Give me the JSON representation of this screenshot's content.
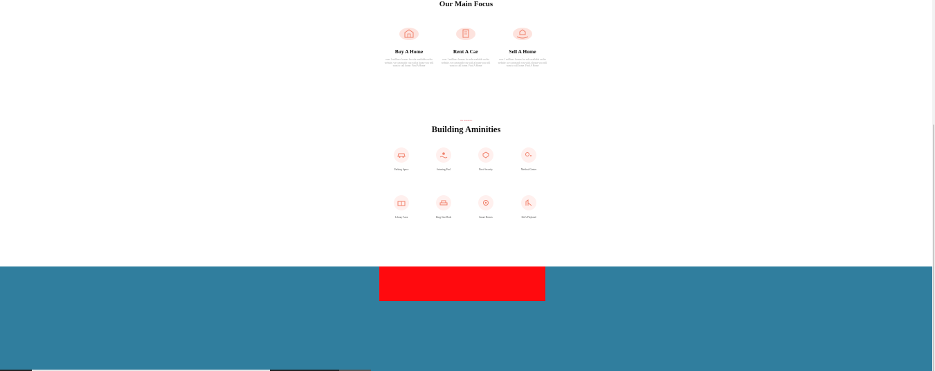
{
  "focus": {
    "heading": "Our Main Focus",
    "items": [
      {
        "title": "Buy A Home",
        "description": "over 1 million+ homes for sale available on the website, we can match you with a house you will want to call home. Find A Home",
        "icon": "house-sign-icon"
      },
      {
        "title": "Rent A Car",
        "description": "over 1 million+ homes for sale available on the website, we can match you with a house you will want to call home. Find A Home",
        "icon": "building-key-icon"
      },
      {
        "title": "Sell A Home",
        "description": "over 1 million+ homes for sale available on the website, we can match you with a house you will want to call home. Find A Home",
        "icon": "hand-house-icon"
      }
    ]
  },
  "amenities": {
    "eyebrow": "Our Amenities",
    "heading": "Building Aminities",
    "items": [
      {
        "label": "Parking Space",
        "icon": "car-icon"
      },
      {
        "label": "Swiming Pool",
        "icon": "pool-icon"
      },
      {
        "label": "Pirvt Security",
        "icon": "shield-icon"
      },
      {
        "label": "Medical Center",
        "icon": "medical-icon"
      },
      {
        "label": "Library Area",
        "icon": "library-icon"
      },
      {
        "label": "King Size Beds",
        "icon": "bed-icon"
      },
      {
        "label": "Smart Homes",
        "icon": "smart-home-icon"
      },
      {
        "label": "Kid's Playland",
        "icon": "playground-icon"
      }
    ]
  },
  "colors": {
    "accent": "#f0806a",
    "accent_soft": "#fde3de",
    "footer": "#307e9e",
    "footer_block": "#ff0a0e"
  }
}
